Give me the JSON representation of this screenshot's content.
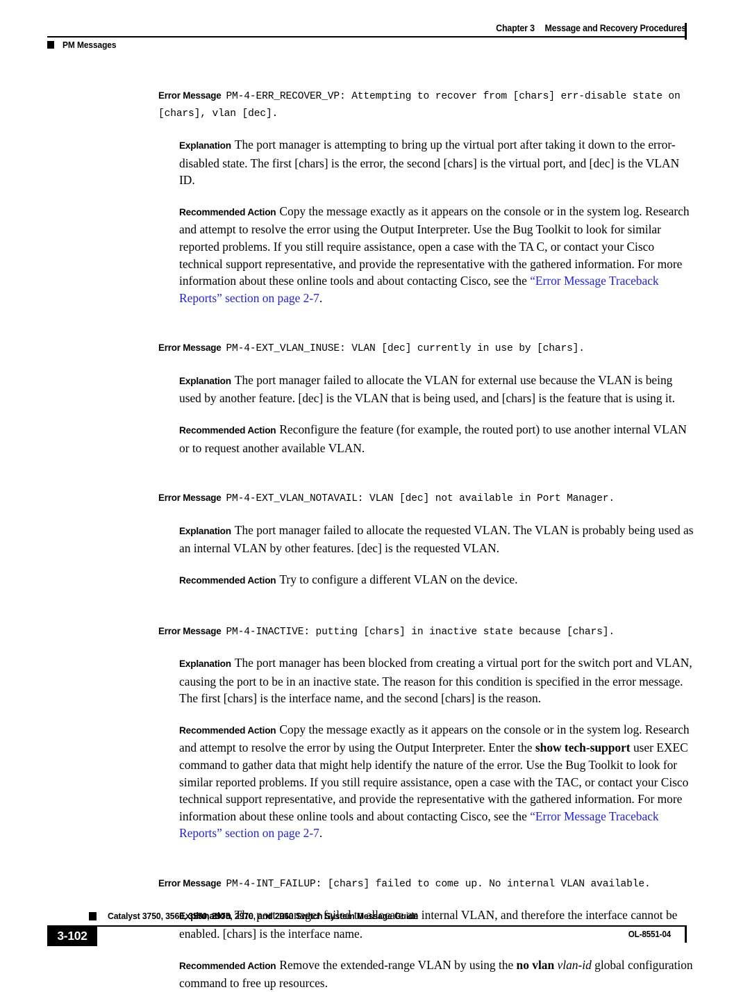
{
  "header": {
    "chapter_number": "Chapter 3",
    "chapter_title": "Message and Recovery Procedures",
    "section_label": "PM Messages"
  },
  "footer": {
    "book_title": "Catalyst 3750, 3560, 3550, 2975, 2970, and 2960 Switch System Message Guide",
    "page_number": "3-102",
    "doc_id": "OL-8551-04"
  },
  "labels": {
    "error_message": "Error Message",
    "explanation": "Explanation",
    "recommended_action": "Recommended Action"
  },
  "link_color": "#2222dd",
  "messages": [
    {
      "code": "PM-4-ERR_RECOVER_VP: Attempting to recover from [chars] err-disable state on [chars], vlan [dec].",
      "explanation": "The port manager is attempting to bring up the virtual port after taking it down to the error-disabled state. The first [chars] is the error, the second [chars] is the virtual port, and [dec] is the VLAN ID.",
      "action_pre": "Copy the message exactly as it appears on the console or in the system log. Research and attempt to resolve the error using the Output Interpreter. Use the Bug Toolkit to look for similar reported problems. If you still require assistance, open a case with the TA C, or contact your Cisco technical support representative, and provide the representative with the gathered information. For more information about these online tools and about contacting Cisco, see the ",
      "action_link": "“Error Message Traceback Reports” section on page 2-7",
      "action_post": "."
    },
    {
      "code": "PM-4-EXT_VLAN_INUSE: VLAN [dec] currently in use by [chars].",
      "explanation": "The port manager failed to allocate the VLAN for external use because the VLAN is being used by another feature. [dec] is the VLAN that is being used, and [chars] is the feature that is using it.",
      "action_pre": "Reconfigure the feature (for example, the routed port) to use another internal VLAN or to request another available VLAN.",
      "action_link": "",
      "action_post": ""
    },
    {
      "code": "PM-4-EXT_VLAN_NOTAVAIL: VLAN [dec] not available in Port Manager.",
      "explanation": "The port manager failed to allocate the requested VLAN. The VLAN is probably being used as an internal VLAN by other features. [dec] is the requested VLAN.",
      "action_pre": "Try to configure a different VLAN on the device.",
      "action_link": "",
      "action_post": ""
    },
    {
      "code": "PM-4-INACTIVE: putting [chars] in inactive state because [chars].",
      "explanation": "The port manager has been blocked from creating a virtual port for the switch port and VLAN, causing the port to be in an inactive state. The reason for this condition is specified in the error message. The first [chars] is the interface name, and the second [chars] is the reason.",
      "action_p1": "Copy the message exactly as it appears on the console or in the system log. Research and attempt to resolve the error by using the Output Interpreter. Enter the ",
      "action_bold1": "show tech-support",
      "action_p2": " user EXEC command to gather data that might help identify the nature of the error. Use the Bug Toolkit to look for similar reported problems. If you still require assistance, open a case with the TAC, or contact your Cisco technical support representative, and provide the representative with the gathered information. For more information about these online tools and about contacting Cisco, see the ",
      "action_link": "“Error Message Traceback Reports” section on page 2-7",
      "action_post": "."
    },
    {
      "code": "PM-4-INT_FAILUP: [chars] failed to come up. No internal VLAN available.",
      "explanation": "The port manager failed to allocate an internal VLAN, and therefore the interface cannot be enabled. [chars] is the interface name.",
      "action_p1": "Remove the extended-range VLAN by using the ",
      "action_bold1": "no vlan",
      "action_ital1": "vlan-id",
      "action_p2": " global configuration command to free up resources.",
      "action_link": "",
      "action_post": ""
    }
  ]
}
